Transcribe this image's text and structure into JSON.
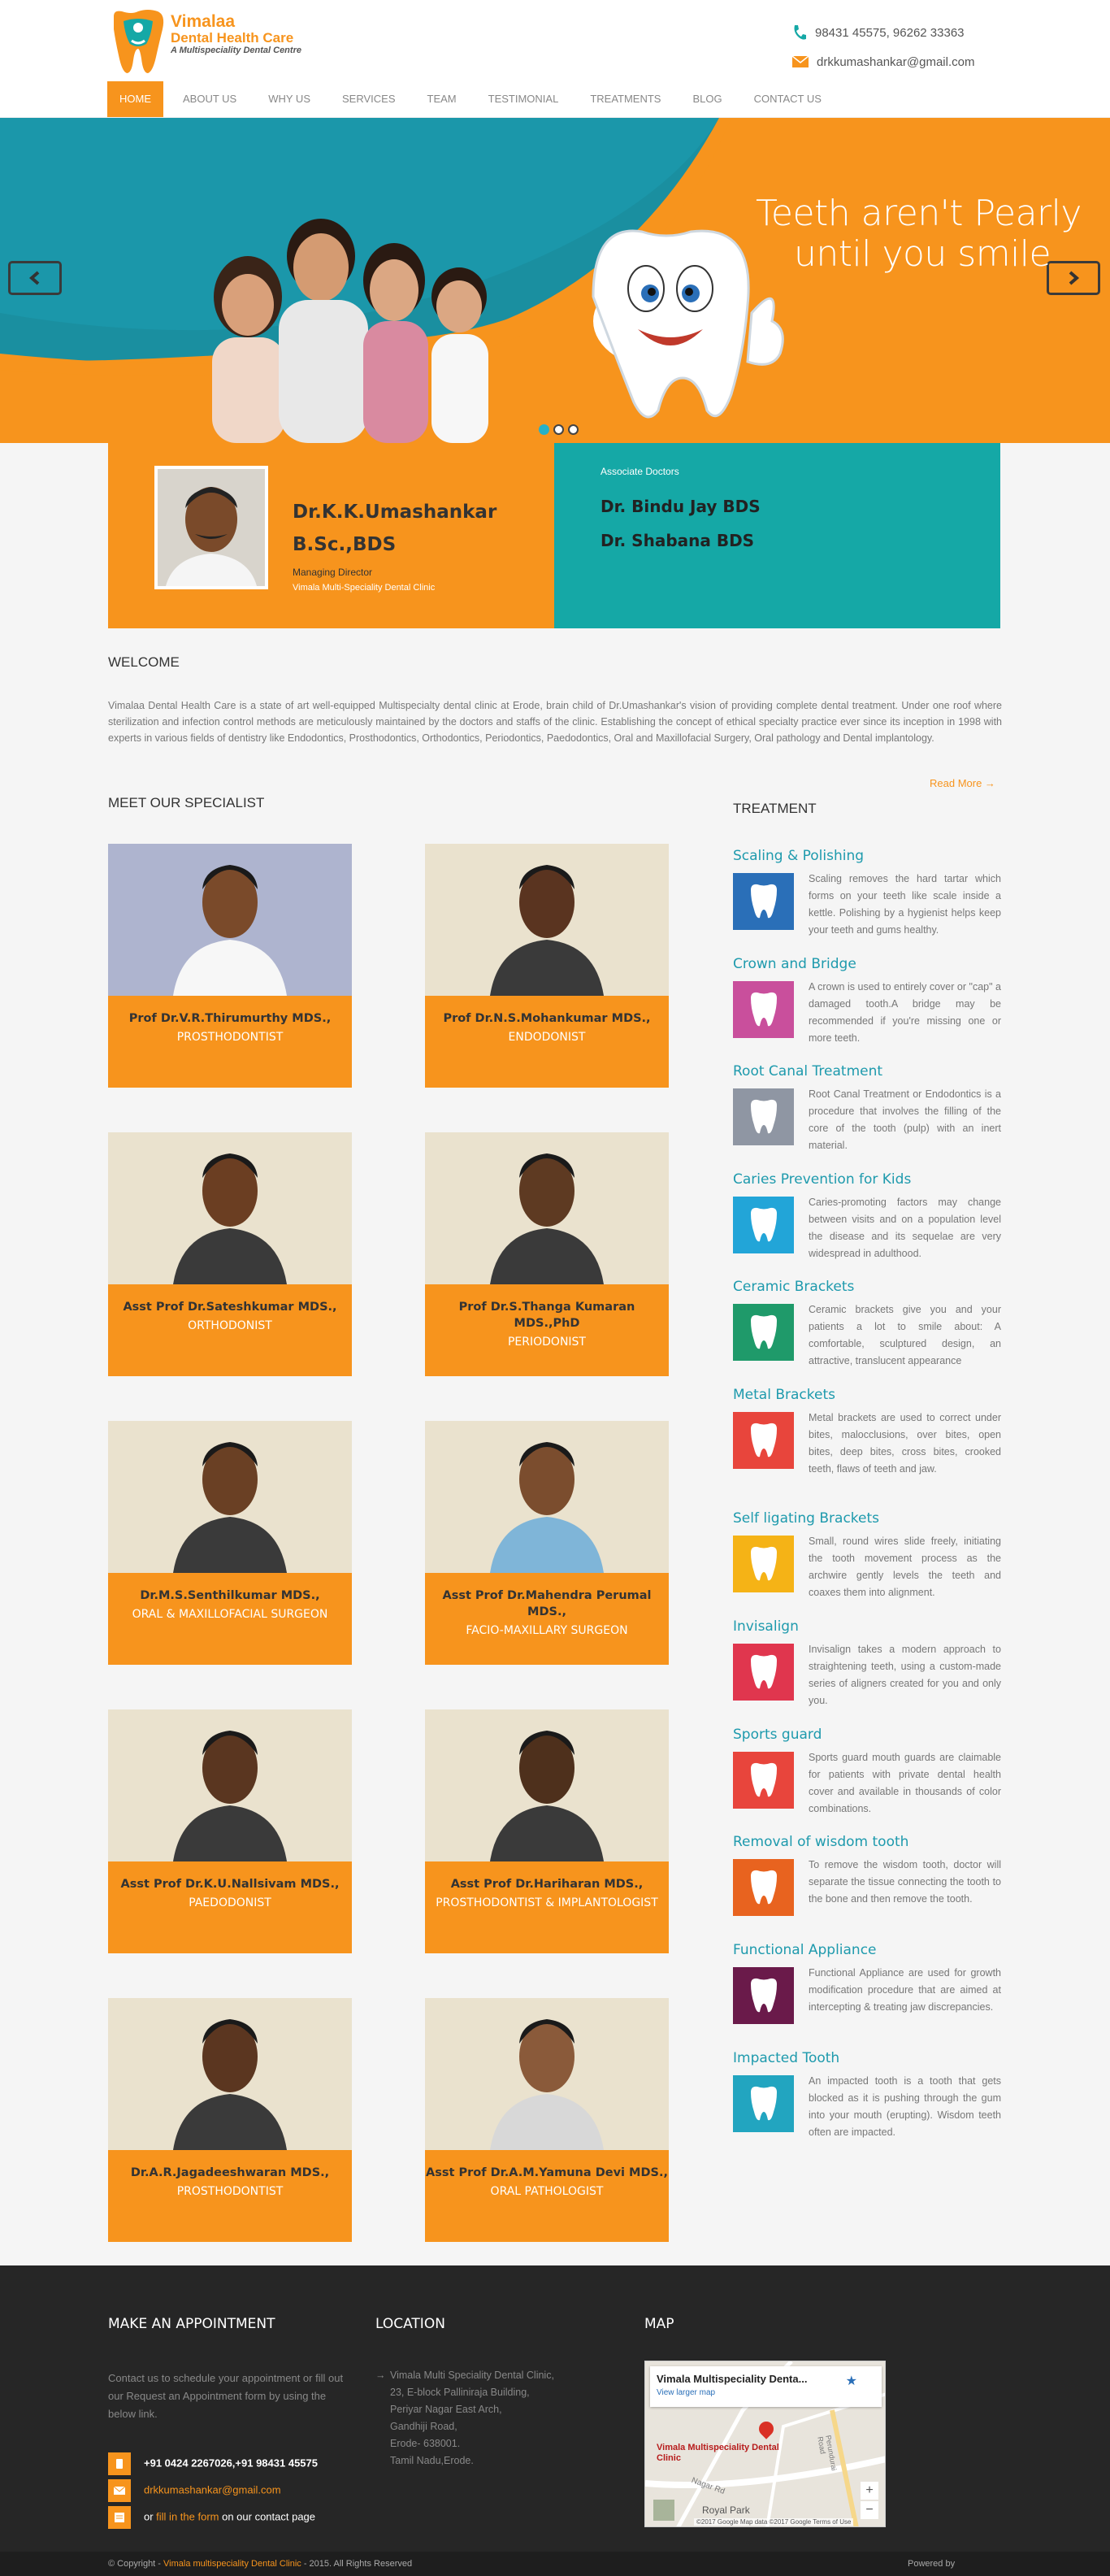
{
  "brand": {
    "name1": "Vimalaa",
    "name2": "Dental Health Care",
    "tagline": "A Multispeciality Dental Centre",
    "colors": {
      "accent": "#f7941d",
      "teal": "#15a8a6",
      "link": "#1e9aad",
      "footer": "#262626"
    }
  },
  "contact": {
    "phone": "98431 45575, 96262 33363",
    "email": "drkkumashankar@gmail.com"
  },
  "nav": [
    {
      "label": "HOME"
    },
    {
      "label": "ABOUT US"
    },
    {
      "label": "WHY US"
    },
    {
      "label": "SERVICES"
    },
    {
      "label": "TEAM"
    },
    {
      "label": "TESTIMONIAL"
    },
    {
      "label": "TREATMENTS"
    },
    {
      "label": "BLOG"
    },
    {
      "label": "CONTACT US"
    }
  ],
  "slider": {
    "line1": "Teeth aren't Pearly",
    "line2": "until you smile",
    "prev_icon": "chevron-left-icon",
    "next_icon": "chevron-right-icon"
  },
  "managing_director": {
    "name": "Dr.K.K.Umashankar",
    "degree": "B.Sc.,BDS",
    "role": "Managing Director",
    "clinic": "Vimala Multi-Speciality Dental Clinic"
  },
  "associates": {
    "label": "Associate Doctors",
    "names": [
      "Dr. Bindu Jay BDS",
      "Dr. Shabana BDS"
    ]
  },
  "welcome": {
    "heading": "WELCOME",
    "text": "Vimalaa Dental Health Care is a state of art well-equipped Multispecialty dental clinic at Erode, brain child of Dr.Umashankar's vision of providing complete dental treatment. Under one roof where sterilization and infection control methods are meticulously maintained by the doctors and staffs of the clinic. Establishing the concept of ethical specialty practice ever since its inception in 1998 with experts in various fields of dentistry like Endodontics, Prosthodontics, Orthodontics, Periodontics, Paedodontics, Oral and Maxillofacial Surgery, Oral pathology and Dental implantology.",
    "read_more": "Read More →"
  },
  "specialists": {
    "heading": "MEET OUR SPECIALIST",
    "items": [
      {
        "name": "Prof Dr.V.R.Thirumurthy MDS.,",
        "spec": "PROSTHODONTIST"
      },
      {
        "name": "Prof Dr.N.S.Mohankumar MDS.,",
        "spec": "ENDODONIST"
      },
      {
        "name": "Asst Prof Dr.Sateshkumar MDS.,",
        "spec": "ORTHODONIST"
      },
      {
        "name": "Prof Dr.S.Thanga Kumaran MDS.,PhD",
        "spec": "PERIODONIST"
      },
      {
        "name": "Dr.M.S.Senthilkumar MDS.,",
        "spec": "ORAL & MAXILLOFACIAL SURGEON"
      },
      {
        "name": "Asst Prof Dr.Mahendra Perumal MDS.,",
        "spec": "FACIO-MAXILLARY SURGEON"
      },
      {
        "name": "Asst Prof Dr.K.U.Nallsivam MDS.,",
        "spec": "PAEDODONIST"
      },
      {
        "name": "Asst Prof Dr.Hariharan MDS.,",
        "spec": "PROSTHODONTIST & IMPLANTOLOGIST"
      },
      {
        "name": "Dr.A.R.Jagadeeshwaran MDS.,",
        "spec": "PROSTHODONTIST"
      },
      {
        "name": "Asst Prof Dr.A.M.Yamuna Devi MDS.,",
        "spec": "ORAL PATHOLOGIST"
      }
    ]
  },
  "treatment": {
    "heading": "TREATMENT",
    "items": [
      {
        "title": "Scaling & Polishing",
        "desc": "Scaling removes the hard tartar which forms on your teeth like scale inside a kettle. Polishing by a hygienist helps keep your teeth and gums healthy.",
        "icon": "sparkling-tooth-icon",
        "color": "#2a6fb8"
      },
      {
        "title": "Crown and Bridge",
        "desc": "A crown is used to entirely cover or \"cap\" a damaged tooth.A bridge may be recommended if you're missing one or more teeth.",
        "icon": "crown-tooth-icon",
        "color": "#c94f9c"
      },
      {
        "title": "Root Canal Treatment",
        "desc": "Root Canal Treatment or Endodontics is a procedure that involves the filling of the core of the tooth (pulp) with an inert material.",
        "icon": "root-canal-icon",
        "color": "#8f96a3"
      },
      {
        "title": "Caries Prevention for Kids",
        "desc": "Caries-promoting factors may change between visits and on a population level the disease and its sequelae are very widespread in adulthood.",
        "icon": "caries-tooth-icon",
        "color": "#22a5d8"
      },
      {
        "title": "Ceramic Brackets",
        "desc": "Ceramic brackets give you and your patients a lot to smile about: A comfortable, sculptured design, an attractive, translucent appearance",
        "icon": "ceramic-brackets-icon",
        "color": "#1f9a6a"
      },
      {
        "title": "Metal Brackets",
        "desc": "Metal brackets are used to correct under bites, malocclusions, over bites, open bites, deep bites, cross bites, crooked teeth, flaws of teeth and jaw.",
        "icon": "metal-brackets-icon",
        "color": "#e8453c"
      },
      {
        "title": "Self ligating Brackets",
        "desc": "Small, round wires slide freely, initiating the tooth movement process as the archwire gently levels the teeth and coaxes them into alignment.",
        "icon": "ligating-brackets-icon",
        "color": "#f5b316"
      },
      {
        "title": "Invisalign",
        "desc": "Invisalign takes a modern approach to straightening teeth, using a custom-made series of aligners created for you and only you.",
        "icon": "aligner-icon",
        "color": "#e0364e"
      },
      {
        "title": "Sports guard",
        "desc": "Sports guard mouth guards are claimable for patients with private dental health cover and available in thousands of color combinations.",
        "icon": "sports-guard-icon",
        "color": "#e8453c"
      },
      {
        "title": "Removal of wisdom tooth",
        "desc": "To remove the wisdom tooth, doctor will separate the tissue connecting the tooth to the bone and then remove the tooth.",
        "icon": "wisdom-tooth-icon",
        "color": "#e8631f"
      },
      {
        "title": "Functional Appliance",
        "desc": "Functional Appliance are used for growth modification procedure that are aimed at intercepting & treating jaw discrepancies.",
        "icon": "functional-appliance-icon",
        "color": "#6a1a4a"
      },
      {
        "title": "Impacted Tooth",
        "desc": "An impacted tooth is a tooth that gets blocked as it is pushing through the gum into your mouth (erupting). Wisdom teeth often are impacted.",
        "icon": "impacted-tooth-icon",
        "color": "#22a5c0"
      }
    ]
  },
  "footer": {
    "appointment": {
      "heading": "MAKE AN APPOINTMENT",
      "intro": "Contact us to schedule your appointment or fill out our Request an Appointment form by using the below link.",
      "phone": "+91 0424 2267026,+91 98431 45575",
      "email": "drkkumashankar@gmail.com",
      "form_pre": "or ",
      "form_link": "fill in the form",
      "form_post": " on our contact page"
    },
    "location": {
      "heading": "LOCATION",
      "lines": [
        "Vimala Multi Speciality Dental Clinic,",
        "23, E-block Palliniraja Building,",
        "Periyar Nagar East Arch,",
        "Gandhiji Road,",
        "Erode- 638001.",
        "Tamil Nadu,Erode."
      ]
    },
    "map": {
      "heading": "MAP",
      "place": "Vimala Multispeciality Denta...",
      "larger": "View larger map",
      "pin_label": "Vimala Multispeciality Dental Clinic",
      "street1": "Nagar Rd",
      "street2": "Royal Park",
      "road": "Perundurai Road",
      "credit": "©2017 Google   Map data ©2017 Google   Terms of Use"
    },
    "copyright_pre": "© Copyright - ",
    "copyright_name": "Vimala multispeciality Dental Clinic",
    "copyright_post": " - 2015. All Rights Reserved",
    "powered": "Powered by"
  }
}
